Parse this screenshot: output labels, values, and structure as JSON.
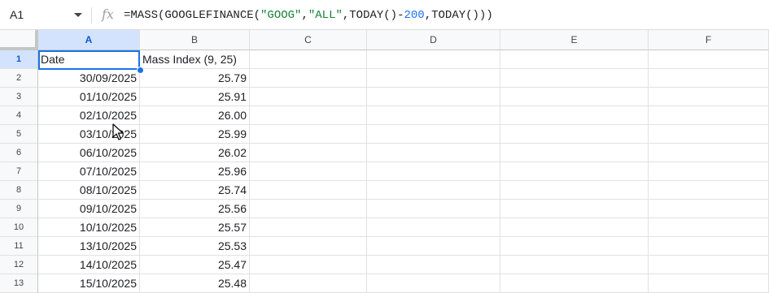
{
  "formula_bar": {
    "cell_ref": "A1",
    "fx_label": "fx",
    "formula": {
      "fn": "=MASS(GOOGLEFINANCE(",
      "arg1": "\"GOOG\"",
      "comma1": ",",
      "arg2": "\"ALL\"",
      "mid": ",TODAY()-",
      "num": "200",
      "end": ",TODAY()))"
    }
  },
  "columns": [
    "A",
    "B",
    "C",
    "D",
    "E",
    "F"
  ],
  "row_numbers": [
    "1",
    "2",
    "3",
    "4",
    "5",
    "6",
    "7",
    "8",
    "9",
    "10",
    "11",
    "12",
    "13"
  ],
  "header_row": {
    "a": "Date",
    "b": "Mass Index (9, 25)"
  },
  "rows": [
    {
      "a": "30/09/2025",
      "b": "25.79"
    },
    {
      "a": "01/10/2025",
      "b": "25.91"
    },
    {
      "a": "02/10/2025",
      "b": "26.00"
    },
    {
      "a": "03/10/2025",
      "b": "25.99"
    },
    {
      "a": "06/10/2025",
      "b": "26.02"
    },
    {
      "a": "07/10/2025",
      "b": "25.96"
    },
    {
      "a": "08/10/2025",
      "b": "25.74"
    },
    {
      "a": "09/10/2025",
      "b": "25.56"
    },
    {
      "a": "10/10/2025",
      "b": "25.57"
    },
    {
      "a": "13/10/2025",
      "b": "25.53"
    },
    {
      "a": "14/10/2025",
      "b": "25.47"
    },
    {
      "a": "15/10/2025",
      "b": "25.48"
    }
  ],
  "colors": {
    "accent": "#1a73e8",
    "header_selected": "#d3e3fd",
    "string_green": "#188038"
  },
  "icons": {
    "name_box_dropdown": "chevron-down-icon",
    "formula_icon": "function-icon",
    "cursor": "mouse-pointer-icon"
  }
}
